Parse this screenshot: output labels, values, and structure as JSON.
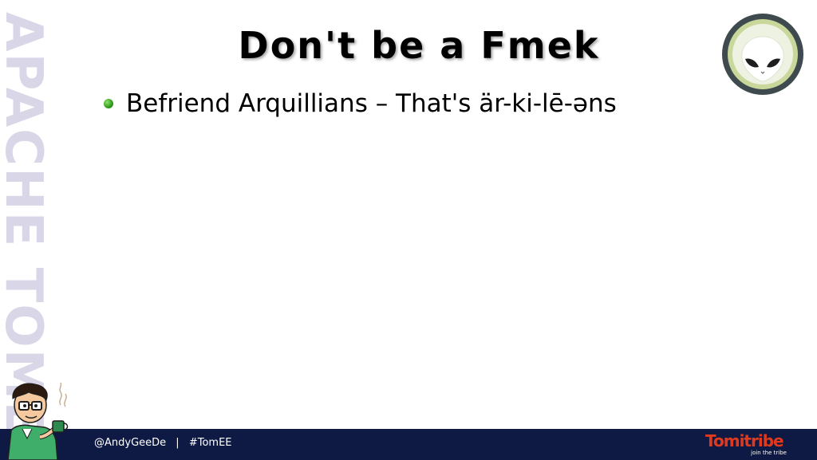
{
  "slide": {
    "watermark": "APACHE TOMEE",
    "title": "Don't be a Fmek",
    "bullets": [
      {
        "text": "Befriend Arquillians – That's är-ki-lē-əns"
      }
    ]
  },
  "footer": {
    "handle": "@AndyGeeDe",
    "separator": "|",
    "hashtag": "#TomEE"
  },
  "brand": {
    "name": "Tomitribe",
    "tagline": "join the tribe",
    "color": "#e03a1e"
  },
  "icons": {
    "top_right": "alien-head-icon",
    "bottom_left": "mascot-with-coffee-icon",
    "bullet": "green-bullet-icon"
  },
  "colors": {
    "footer_background": "#0f1a44",
    "watermark": "#d9d6e8"
  }
}
